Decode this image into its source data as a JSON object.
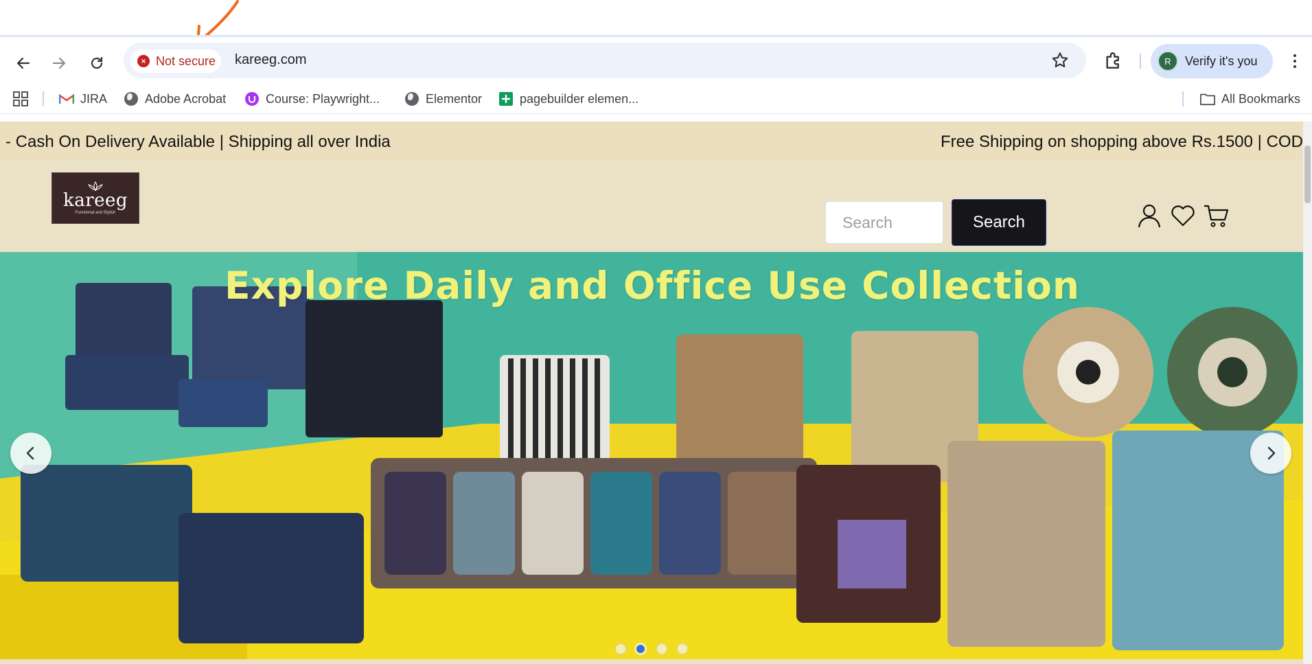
{
  "browser": {
    "security_label": "Not secure",
    "url": "kareeg.com",
    "profile_initial": "R",
    "profile_label": "Verify it's you",
    "bookmarks": [
      {
        "label": "JIRA",
        "icon": "gmail-icon"
      },
      {
        "label": "Adobe Acrobat",
        "icon": "globe-icon"
      },
      {
        "label": "Course: Playwright...",
        "icon": "udemy-icon"
      },
      {
        "label": "Elementor",
        "icon": "globe-icon"
      },
      {
        "label": "pagebuilder elemen...",
        "icon": "sheets-icon"
      }
    ],
    "all_bookmarks_label": "All Bookmarks"
  },
  "site": {
    "announcement_left": "- Cash On Delivery Available | Shipping all over India",
    "announcement_right": "Free Shipping on shopping above Rs.1500 | COD",
    "logo_name": "kareeg",
    "logo_tagline": "Functional and Stylish",
    "search_placeholder": "Search",
    "search_button": "Search",
    "hero_title": "Explore Daily and Office Use Collection",
    "slides": {
      "count": 4,
      "active": 2
    }
  },
  "colors": {
    "announcement_bg": "#ecdfbd",
    "header_bg": "#ebe1c6",
    "hero_title": "#f1f27a",
    "search_button_bg": "#15151a",
    "not_secure": "#c5221f"
  }
}
